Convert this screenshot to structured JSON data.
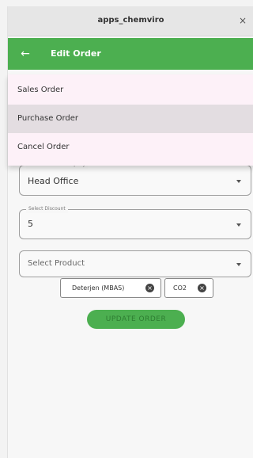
{
  "window": {
    "title": "apps_chemviro",
    "close_glyph": "×"
  },
  "appbar": {
    "title": "Edit Order",
    "back_icon": "arrow-left-icon",
    "back_glyph": "←"
  },
  "menu": {
    "items": [
      {
        "label": "Sales Order"
      },
      {
        "label": "Purchase Order",
        "highlighted": true
      },
      {
        "label": "Cancel Order"
      }
    ]
  },
  "form": {
    "branch": {
      "label": "Select Branch Company",
      "value": "Head Office"
    },
    "discount": {
      "label": "Select Discount",
      "value": "5"
    },
    "product": {
      "placeholder": "Select Product"
    },
    "chips": [
      {
        "label": "Deterjen (MBAS)",
        "remove_glyph": "×"
      },
      {
        "label": "CO2",
        "remove_glyph": "×"
      }
    ],
    "update_button": "UPDATE ORDER"
  },
  "colors": {
    "accent": "#4caf50",
    "menu_bg": "#fdf1f8",
    "menu_highlight": "#e3dde1"
  }
}
